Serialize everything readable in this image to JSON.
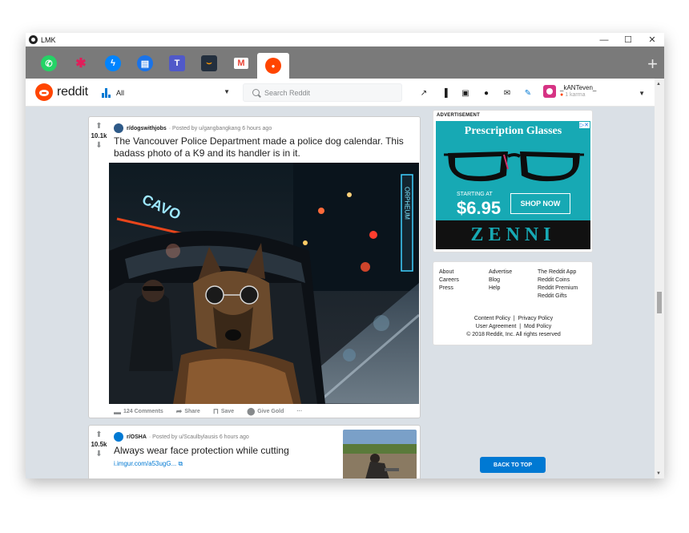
{
  "window": {
    "title": "LMK",
    "minimize": "—",
    "maximize": "☐",
    "close": "✕"
  },
  "tabs": [
    {
      "name": "whatsapp",
      "color": "#25d366",
      "glyph": "✆"
    },
    {
      "name": "slack",
      "color": "#7a7a7a",
      "glyph": "✱"
    },
    {
      "name": "messenger",
      "color": "#0084ff",
      "glyph": "ϟ"
    },
    {
      "name": "chat",
      "color": "#1a73e8",
      "glyph": "▤"
    },
    {
      "name": "teams",
      "color": "#5059c9",
      "glyph": "T"
    },
    {
      "name": "amazon",
      "color": "#232f3e",
      "glyph": "⌣"
    },
    {
      "name": "gmail",
      "color": "#ea4335",
      "glyph": "M"
    },
    {
      "name": "reddit",
      "color": "#ff4500",
      "glyph": "●"
    }
  ],
  "tab_add": "+",
  "navbar": {
    "brand": "reddit",
    "feed": "All",
    "feed_caret": "▼",
    "search_placeholder": "Search Reddit",
    "icons": [
      "trending-icon",
      "stats-icon",
      "video-icon",
      "chat-icon",
      "mail-icon",
      "pencil-icon"
    ],
    "icon_glyphs": [
      "↗",
      "▐",
      "▣",
      "●",
      "✉",
      "✎"
    ],
    "username": "_kANTeven_",
    "karma": "1 karma",
    "karma_dot": "●",
    "user_caret": "▼"
  },
  "post1": {
    "score": "10.1k",
    "upvote": "⬆",
    "downvote": "⬇",
    "subreddit": "r/dogswithjobs",
    "posted_by": "· Posted by u/gangbangkang 6 hours ago",
    "title": "The Vancouver Police Department made a police dog calendar. This badass photo of a K9 and its handler is in it.",
    "comments": "124 Comments",
    "share": "Share",
    "save": "Save",
    "give_gold": "Give Gold",
    "more": "···",
    "sign_left": "CAVO",
    "sign_right": "ORPHEUM"
  },
  "post2": {
    "score": "10.5k",
    "upvote": "⬆",
    "downvote": "⬇",
    "subreddit": "r/OSHA",
    "posted_by": "· Posted by u/Scaulbylausis 6 hours ago",
    "title": "Always wear face protection while cutting",
    "link": "i.imgur.com/a53ugG...",
    "link_icon": "⧉"
  },
  "ad": {
    "label": "ADVERTISEMENT",
    "title": "Prescription Glasses",
    "x_label": "▷✕",
    "starting_at": "STARTING AT",
    "price": "$6.95",
    "cta": "SHOP NOW",
    "brand": "ZENNI",
    "teal": "#17a9b4"
  },
  "footer": {
    "col1": [
      "About",
      "Careers",
      "Press"
    ],
    "col2": [
      "Advertise",
      "Blog",
      "Help"
    ],
    "col3": [
      "The Reddit App",
      "Reddit Coins",
      "Reddit Premium",
      "Reddit Gifts"
    ],
    "legal1": "Content Policy  |  Privacy Policy",
    "legal2": "User Agreement  |  Mod Policy",
    "copyright": "© 2018 Reddit, Inc. All rights reserved"
  },
  "back_to_top": "BACK TO TOP",
  "scroll": {
    "up": "▲",
    "down": "▼"
  },
  "colors": {
    "reddit_orange": "#ff4500",
    "reddit_blue": "#0079d3",
    "page_bg": "#dae0e6"
  }
}
